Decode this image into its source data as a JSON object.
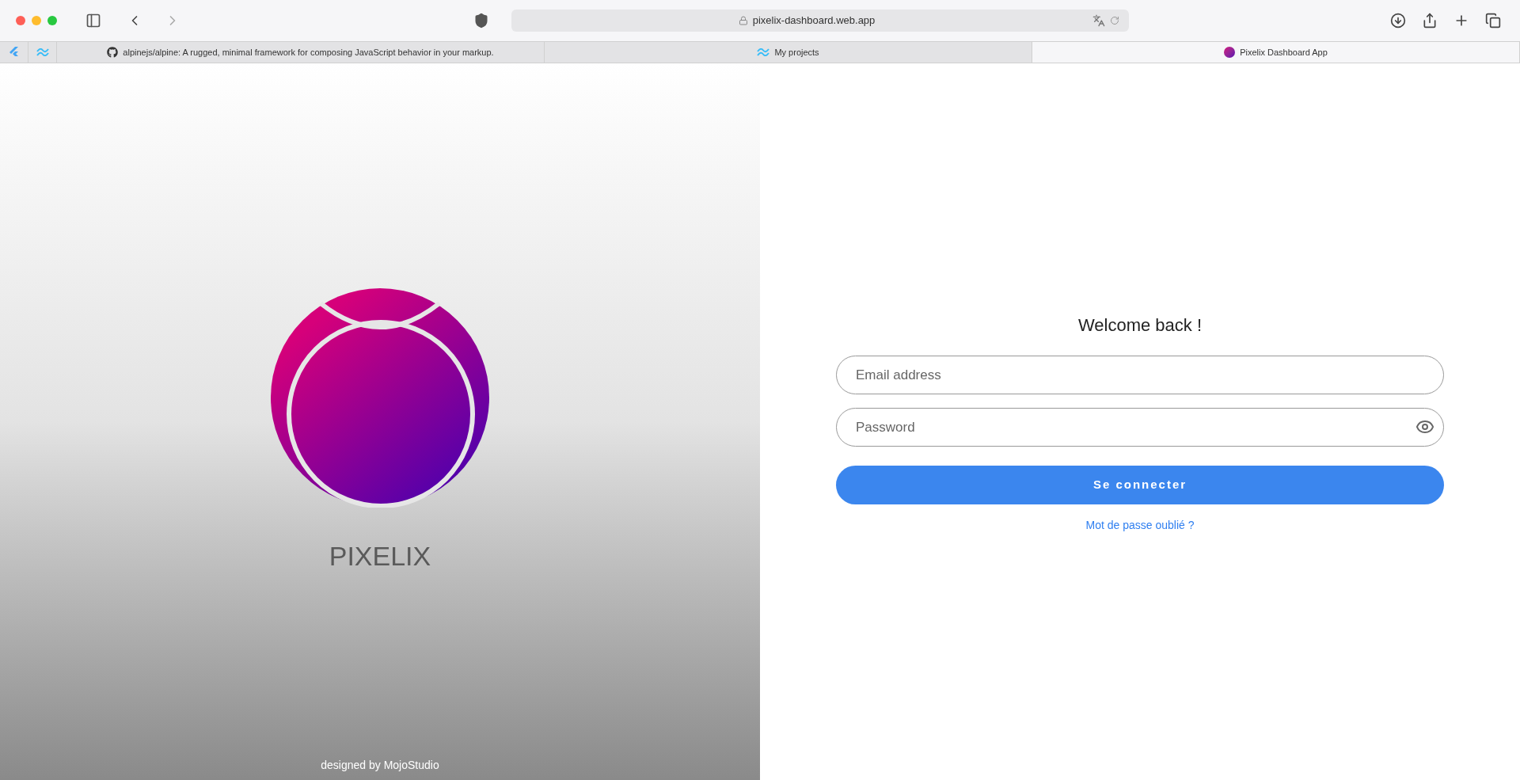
{
  "browser": {
    "url": "pixelix-dashboard.web.app"
  },
  "tabs": [
    {
      "kind": "pinned",
      "selected": false
    },
    {
      "kind": "pinned",
      "selected": false
    },
    {
      "kind": "titled",
      "label": "alpinejs/alpine: A rugged, minimal framework for composing JavaScript behavior in your markup.",
      "selected": false
    },
    {
      "kind": "titled",
      "label": "My projects",
      "selected": false
    },
    {
      "kind": "titled",
      "label": "Pixelix Dashboard App",
      "selected": true
    }
  ],
  "brand": {
    "name": "PIXELIX",
    "credit": "designed by MojoStudio"
  },
  "login": {
    "title": "Welcome back !",
    "email": {
      "placeholder": "Email address"
    },
    "password": {
      "placeholder": "Password"
    },
    "submit": "Se connecter",
    "forgot": "Mot de passe oublié ?"
  }
}
